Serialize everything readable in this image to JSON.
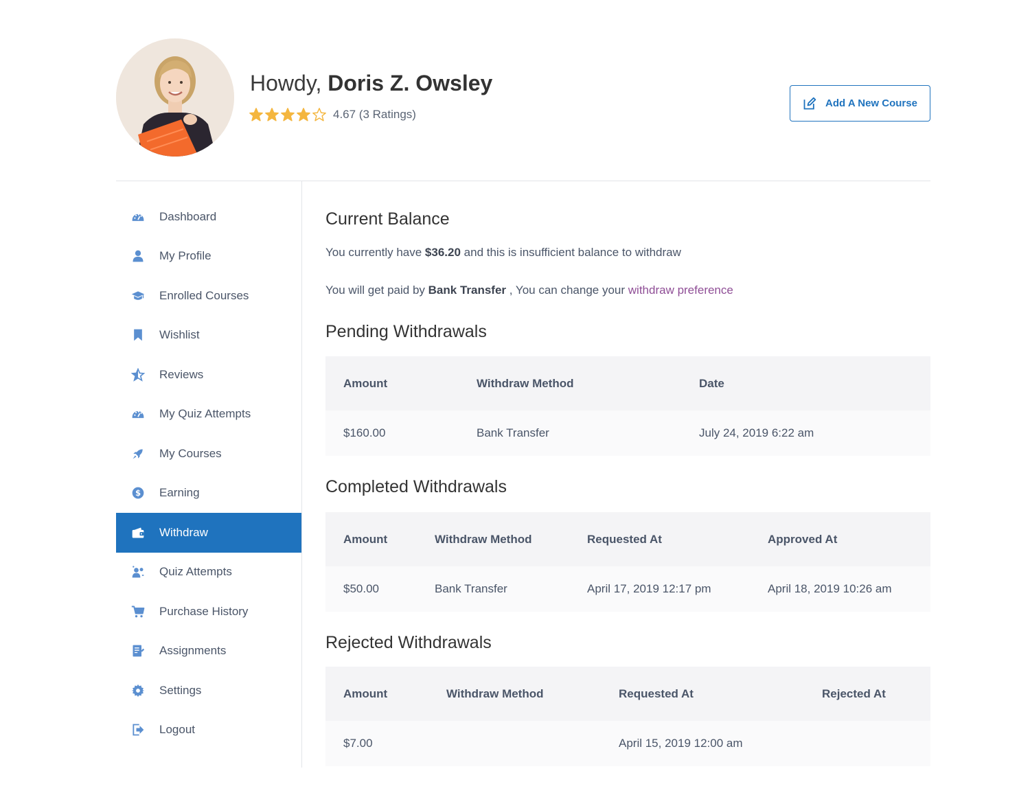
{
  "header": {
    "greeting_prefix": "Howdy,",
    "user_name": "Doris Z. Owsley",
    "rating_value": 4.67,
    "rating_max": 5,
    "rating_text": "4.67 (3 Ratings)",
    "add_course_label": "Add A New Course"
  },
  "colors": {
    "accent": "#1f73be",
    "star": "#f4b63f",
    "link": "#8f4e96"
  },
  "sidebar": {
    "items": [
      {
        "label": "Dashboard",
        "icon": "dashboard-gauge-icon"
      },
      {
        "label": "My Profile",
        "icon": "user-icon"
      },
      {
        "label": "Enrolled Courses",
        "icon": "graduation-cap-icon"
      },
      {
        "label": "Wishlist",
        "icon": "bookmark-icon"
      },
      {
        "label": "Reviews",
        "icon": "star-icon"
      },
      {
        "label": "My Quiz Attempts",
        "icon": "gauge-icon"
      },
      {
        "label": "My Courses",
        "icon": "rocket-icon"
      },
      {
        "label": "Earning",
        "icon": "dollar-icon"
      },
      {
        "label": "Withdraw",
        "icon": "wallet-icon",
        "active": true
      },
      {
        "label": "Quiz Attempts",
        "icon": "quiz-users-icon"
      },
      {
        "label": "Purchase History",
        "icon": "cart-icon"
      },
      {
        "label": "Assignments",
        "icon": "assignment-icon"
      },
      {
        "label": "Settings",
        "icon": "gear-icon"
      },
      {
        "label": "Logout",
        "icon": "logout-icon"
      }
    ]
  },
  "balance": {
    "title": "Current Balance",
    "line1_prefix": "You currently have",
    "amount": "$36.20",
    "line1_suffix": "and this is insufficient balance to withdraw",
    "line2_prefix": "You will get paid by",
    "method": "Bank Transfer",
    "line2_middle": ", You can change your",
    "preference_link": "withdraw preference"
  },
  "pending": {
    "title": "Pending Withdrawals",
    "headers": [
      "Amount",
      "Withdraw Method",
      "Date"
    ],
    "rows": [
      [
        "$160.00",
        "Bank Transfer",
        "July 24, 2019 6:22 am"
      ]
    ]
  },
  "completed": {
    "title": "Completed Withdrawals",
    "headers": [
      "Amount",
      "Withdraw Method",
      "Requested At",
      "Approved At"
    ],
    "rows": [
      [
        "$50.00",
        "Bank Transfer",
        "April 17, 2019 12:17 pm",
        "April 18, 2019 10:26 am"
      ]
    ]
  },
  "rejected": {
    "title": "Rejected Withdrawals",
    "headers": [
      "Amount",
      "Withdraw Method",
      "Requested At",
      "Rejected At"
    ],
    "rows": [
      [
        "$7.00",
        "",
        "April 15, 2019 12:00 am",
        ""
      ]
    ]
  }
}
